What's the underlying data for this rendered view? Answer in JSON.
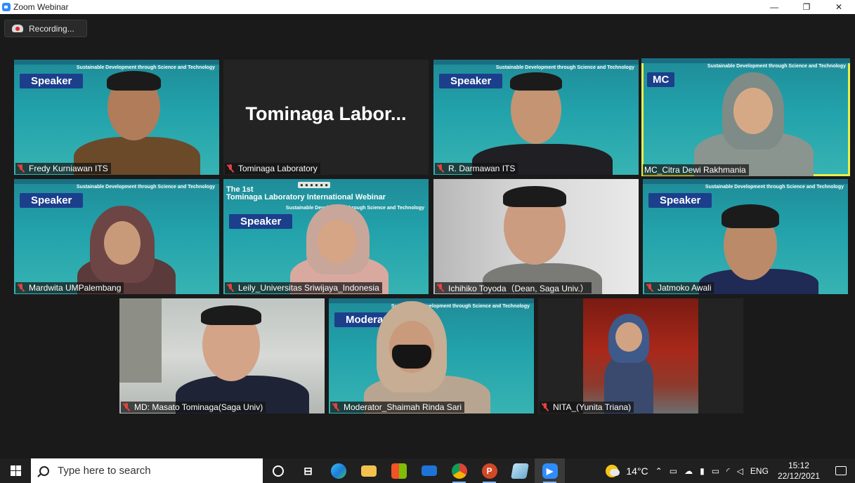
{
  "window": {
    "title": "Zoom Webinar",
    "controls": {
      "minimize": "—",
      "restore": "❐",
      "close": "✕"
    }
  },
  "recording": {
    "label": "Recording..."
  },
  "banner": {
    "subtitle": "Sustainable Development through Science and Technology",
    "first_title": "The 1st\nTominaga Laboratory International Webinar"
  },
  "participants": [
    {
      "name": "Fredy Kurniawan ITS",
      "role": "Speaker",
      "muted": true
    },
    {
      "name": "Tominaga Laboratory",
      "display": "Tominaga  Labor...",
      "muted": true
    },
    {
      "name": "R. Darmawan ITS",
      "role": "Speaker",
      "muted": true
    },
    {
      "name": "MC_Citra Dewi Rakhmania",
      "role": "MC",
      "muted": false,
      "active": true
    },
    {
      "name": "Mardwita UMPalembang",
      "role": "Speaker",
      "muted": true
    },
    {
      "name": "Leily_Universitas Sriwijaya_Indonesia",
      "role": "Speaker",
      "muted": true
    },
    {
      "name": "Ichihiko Toyoda（Dean, Saga Univ.）",
      "muted": true
    },
    {
      "name": "Jatmoko Awali",
      "role": "Speaker",
      "muted": true
    },
    {
      "name": "MD: Masato Tominaga(Saga Univ)",
      "muted": true
    },
    {
      "name": "Moderator_Shaimah Rinda Sari",
      "role": "Moderat",
      "muted": true
    },
    {
      "name": "NITA_(Yunita Triana)",
      "muted": true
    }
  ],
  "taskbar": {
    "search_placeholder": "Type here to search",
    "apps": [
      "cortana-icon",
      "task-view-icon",
      "edge-icon",
      "file-explorer-icon",
      "store-icon",
      "mail-icon",
      "chrome-icon",
      "powerpoint-icon",
      "app-icon",
      "zoom-icon"
    ],
    "weather": "14°C",
    "language": "ENG",
    "time": "15:12",
    "date": "22/12/2021"
  },
  "colors": {
    "accent": "#2d8cff",
    "active_speaker": "#e8f04a",
    "muted": "#e84141",
    "banner_teal": "#22a2ab",
    "role_badge": "#1c3f8c"
  }
}
